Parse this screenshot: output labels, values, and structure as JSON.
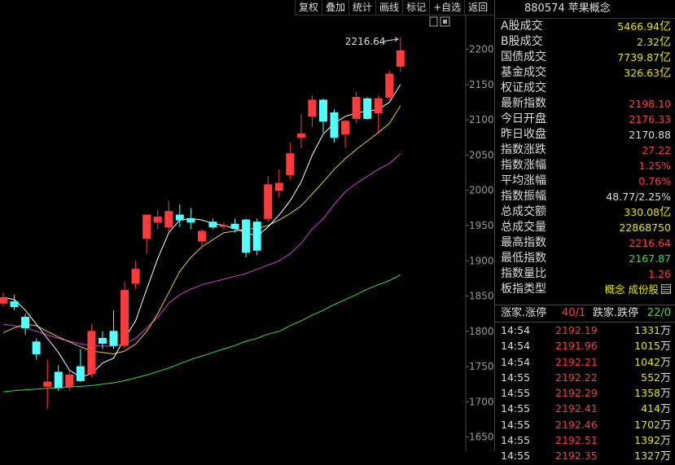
{
  "toolbar": {
    "buttons": [
      "复权",
      "叠加",
      "统计",
      "画线",
      "标记",
      "+自选",
      "返回"
    ]
  },
  "header": {
    "code": "880574",
    "name": "苹果概念"
  },
  "stats": [
    {
      "label": "A股成交",
      "value": "5466.94",
      "unit": "亿",
      "color": "#e6e600"
    },
    {
      "label": "B股成交",
      "value": "2.32",
      "unit": "亿",
      "color": "#e6e600"
    },
    {
      "label": "国债成交",
      "value": "7739.87",
      "unit": "亿",
      "color": "#e6e600"
    },
    {
      "label": "基金成交",
      "value": "326.63",
      "unit": "亿",
      "color": "#e6e600"
    },
    {
      "label": "权证成交",
      "value": "",
      "unit": "",
      "color": "#e6e600"
    },
    {
      "label": "最新指数",
      "value": "2198.10",
      "unit": "",
      "color": "#ff3b3b"
    },
    {
      "label": "今日开盘",
      "value": "2176.33",
      "unit": "",
      "color": "#ff3b3b"
    },
    {
      "label": "昨日收盘",
      "value": "2170.88",
      "unit": "",
      "color": "#dddddd"
    },
    {
      "label": "指数涨跌",
      "value": "27.22",
      "unit": "",
      "color": "#ff3b3b"
    },
    {
      "label": "指数涨幅",
      "value": "1.25%",
      "unit": "",
      "color": "#ff3b3b"
    },
    {
      "label": "平均涨幅",
      "value": "0.76%",
      "unit": "",
      "color": "#ff3b3b"
    },
    {
      "label": "指数振幅",
      "value": "48.77/2.25%",
      "unit": "",
      "color": "#dddddd"
    },
    {
      "label": "总成交额",
      "value": "330.08",
      "unit": "亿",
      "color": "#e6e600"
    },
    {
      "label": "总成交量",
      "value": "22868750",
      "unit": "",
      "color": "#e6e600"
    },
    {
      "label": "最高指数",
      "value": "2216.64",
      "unit": "",
      "color": "#ff3b3b"
    },
    {
      "label": "最低指数",
      "value": "2167.87",
      "unit": "",
      "color": "#3ddc3d"
    },
    {
      "label": "指数量比",
      "value": "1.26",
      "unit": "",
      "color": "#ff3b3b"
    },
    {
      "label": "板指类型",
      "value": "概念 成份股",
      "unit": "",
      "color": "#e6e600"
    }
  ],
  "updown": {
    "up_label": "涨家.涨停",
    "up_value": "40/1",
    "down_label": "跌家.跌停",
    "down_value": "22/0"
  },
  "trades": [
    {
      "time": "14:54",
      "price": "2192.19",
      "vol": "1331",
      "unit": "万"
    },
    {
      "time": "14:54",
      "price": "2191.96",
      "vol": "1015",
      "unit": "万"
    },
    {
      "time": "14:54",
      "price": "2192.21",
      "vol": "1042",
      "unit": "万"
    },
    {
      "time": "14:55",
      "price": "2192.22",
      "vol": "552",
      "unit": "万"
    },
    {
      "time": "14:55",
      "price": "2192.29",
      "vol": "1358",
      "unit": "万"
    },
    {
      "time": "14:55",
      "price": "2192.41",
      "vol": "414",
      "unit": "万"
    },
    {
      "time": "14:55",
      "price": "2192.46",
      "vol": "1702",
      "unit": "万"
    },
    {
      "time": "14:55",
      "price": "2192.51",
      "vol": "1392",
      "unit": "万"
    },
    {
      "time": "14:55",
      "price": "2192.35",
      "vol": "1327",
      "unit": "万"
    }
  ],
  "chart_data": {
    "type": "candlestick",
    "ylim": [
      1630,
      2240
    ],
    "yticks": [
      2200,
      2150,
      2100,
      2050,
      2000,
      1950,
      1900,
      1850,
      1800,
      1750,
      1700,
      1650
    ],
    "high_marker": "2216.64",
    "colors": {
      "up": "#ff3b3b",
      "down": "#54ffff",
      "ma5": "#ffffff",
      "ma10": "#e6c84a",
      "ma20": "#d43cd4",
      "ma60": "#3ddc3d"
    },
    "candles": [
      {
        "o": 1840,
        "h": 1855,
        "l": 1835,
        "c": 1848
      },
      {
        "o": 1842,
        "h": 1852,
        "l": 1830,
        "c": 1835
      },
      {
        "o": 1820,
        "h": 1825,
        "l": 1795,
        "c": 1805
      },
      {
        "o": 1785,
        "h": 1790,
        "l": 1760,
        "c": 1768
      },
      {
        "o": 1722,
        "h": 1760,
        "l": 1690,
        "c": 1728
      },
      {
        "o": 1742,
        "h": 1752,
        "l": 1715,
        "c": 1720
      },
      {
        "o": 1722,
        "h": 1745,
        "l": 1715,
        "c": 1738
      },
      {
        "o": 1750,
        "h": 1775,
        "l": 1728,
        "c": 1730
      },
      {
        "o": 1740,
        "h": 1810,
        "l": 1735,
        "c": 1800
      },
      {
        "o": 1790,
        "h": 1800,
        "l": 1775,
        "c": 1783
      },
      {
        "o": 1800,
        "h": 1830,
        "l": 1775,
        "c": 1780
      },
      {
        "o": 1780,
        "h": 1870,
        "l": 1775,
        "c": 1858
      },
      {
        "o": 1868,
        "h": 1900,
        "l": 1860,
        "c": 1888
      },
      {
        "o": 1932,
        "h": 1965,
        "l": 1910,
        "c": 1965
      },
      {
        "o": 1955,
        "h": 1972,
        "l": 1945,
        "c": 1962
      },
      {
        "o": 1948,
        "h": 1985,
        "l": 1940,
        "c": 1970
      },
      {
        "o": 1965,
        "h": 1980,
        "l": 1948,
        "c": 1958
      },
      {
        "o": 1960,
        "h": 1975,
        "l": 1945,
        "c": 1955
      },
      {
        "o": 1928,
        "h": 1945,
        "l": 1918,
        "c": 1942
      },
      {
        "o": 1955,
        "h": 1960,
        "l": 1945,
        "c": 1948
      },
      {
        "o": 1950,
        "h": 1955,
        "l": 1944,
        "c": 1950
      },
      {
        "o": 1952,
        "h": 1960,
        "l": 1940,
        "c": 1946
      },
      {
        "o": 1958,
        "h": 1960,
        "l": 1905,
        "c": 1912
      },
      {
        "o": 1955,
        "h": 1960,
        "l": 1908,
        "c": 1915
      },
      {
        "o": 1960,
        "h": 2020,
        "l": 1955,
        "c": 2008
      },
      {
        "o": 2000,
        "h": 2030,
        "l": 1990,
        "c": 2010
      },
      {
        "o": 2022,
        "h": 2068,
        "l": 2015,
        "c": 2052
      },
      {
        "o": 2075,
        "h": 2108,
        "l": 2060,
        "c": 2080
      },
      {
        "o": 2105,
        "h": 2135,
        "l": 2090,
        "c": 2128
      },
      {
        "o": 2128,
        "h": 2130,
        "l": 2082,
        "c": 2098
      },
      {
        "o": 2110,
        "h": 2115,
        "l": 2068,
        "c": 2075
      },
      {
        "o": 2080,
        "h": 2100,
        "l": 2060,
        "c": 2098
      },
      {
        "o": 2102,
        "h": 2140,
        "l": 2095,
        "c": 2132
      },
      {
        "o": 2130,
        "h": 2132,
        "l": 2100,
        "c": 2102
      },
      {
        "o": 2110,
        "h": 2135,
        "l": 2080,
        "c": 2130
      },
      {
        "o": 2132,
        "h": 2170,
        "l": 2128,
        "c": 2165
      },
      {
        "o": 2176,
        "h": 2217,
        "l": 2168,
        "c": 2198
      }
    ],
    "ma5": [
      1848,
      1845,
      1830,
      1810,
      1790,
      1770,
      1745,
      1735,
      1740,
      1755,
      1762,
      1790,
      1815,
      1860,
      1903,
      1940,
      1958,
      1960,
      1958,
      1953,
      1950,
      1946,
      1940,
      1935,
      1948,
      1965,
      1985,
      2012,
      2050,
      2080,
      2095,
      2105,
      2110,
      2112,
      2115,
      2125,
      2150
    ],
    "ma10": [
      1798,
      1805,
      1810,
      1808,
      1800,
      1792,
      1785,
      1778,
      1772,
      1770,
      1768,
      1772,
      1782,
      1800,
      1825,
      1855,
      1885,
      1905,
      1920,
      1930,
      1940,
      1942,
      1945,
      1946,
      1950,
      1958,
      1967,
      1978,
      1995,
      2012,
      2030,
      2045,
      2058,
      2070,
      2082,
      2095,
      2120
    ],
    "ma20": [
      1810,
      1808,
      1805,
      1800,
      1795,
      1790,
      1786,
      1782,
      1780,
      1779,
      1779,
      1782,
      1790,
      1805,
      1820,
      1840,
      1852,
      1860,
      1866,
      1870,
      1874,
      1878,
      1882,
      1888,
      1894,
      1900,
      1910,
      1925,
      1945,
      1960,
      1980,
      1998,
      2010,
      2020,
      2030,
      2038,
      2052
    ],
    "ma60": [
      1714,
      1716,
      1717,
      1718,
      1719,
      1720,
      1721,
      1722,
      1723,
      1725,
      1727,
      1730,
      1734,
      1738,
      1743,
      1748,
      1754,
      1760,
      1765,
      1770,
      1775,
      1780,
      1786,
      1790,
      1796,
      1800,
      1808,
      1815,
      1823,
      1830,
      1838,
      1845,
      1852,
      1860,
      1866,
      1872,
      1880
    ]
  }
}
